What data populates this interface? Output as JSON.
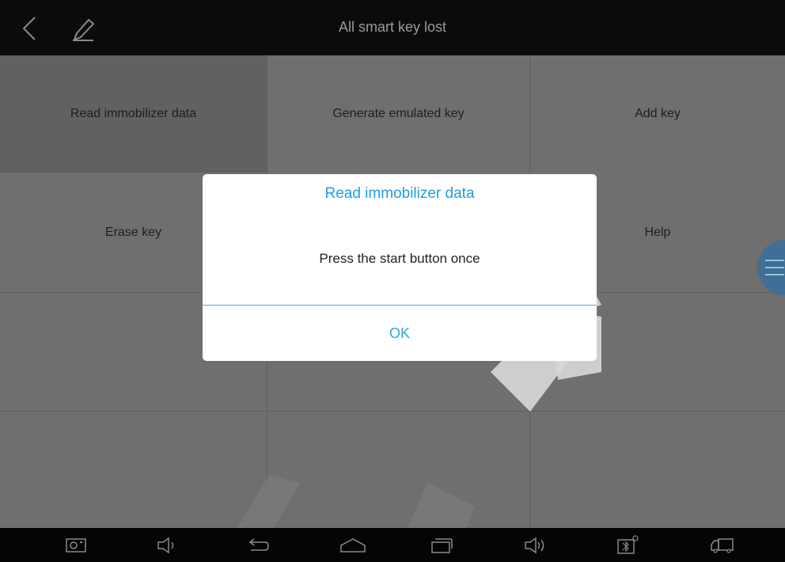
{
  "header": {
    "title": "All smart key lost"
  },
  "menu": {
    "items": [
      {
        "label": "Read immobilizer data"
      },
      {
        "label": "Generate emulated key"
      },
      {
        "label": "Add key"
      },
      {
        "label": "Erase key"
      },
      {
        "label": ""
      },
      {
        "label": "Help"
      }
    ]
  },
  "dialog": {
    "title": "Read immobilizer data",
    "message": "Press the start button once",
    "ok_label": "OK"
  },
  "navbar": {
    "icons": [
      "screenshot-icon",
      "volume-down-icon",
      "back-icon",
      "home-icon",
      "recent-apps-icon",
      "volume-up-icon",
      "vci-status-icon",
      "truck-icon"
    ]
  },
  "colors": {
    "accent": "#1f9de0",
    "topbar": "#0b0b0b",
    "background": "#6f6f6f",
    "dialog": "#ffffff",
    "side_menu": "#3f6f96"
  }
}
